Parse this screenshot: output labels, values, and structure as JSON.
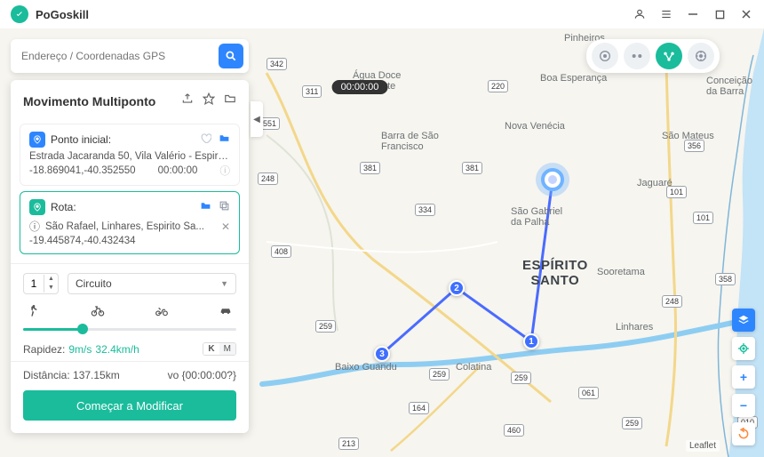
{
  "app": {
    "name": "PoGoskill"
  },
  "search": {
    "placeholder": "Endereço / Coordenadas GPS"
  },
  "panel": {
    "title": "Movimento Multiponto",
    "start_point_label": "Ponto inicial:",
    "start_address": "Estrada Jacaranda 50, Vila Valério - Espirito...",
    "start_coords": "-18.869041,-40.352550",
    "start_time": "00:00:00",
    "route_label": "Rota:",
    "route_address": "São Rafael, Linhares, Espirito Sa...",
    "route_coords": "-19.445874,-40.432434"
  },
  "controls": {
    "loop_count": "1",
    "mode": "Circuito",
    "speed_label": "Rapidez:",
    "speed_ms": "9m/s",
    "speed_kmh": "32.4km/h",
    "unit_k": "K",
    "unit_m": "M",
    "distance_label": "Distância:",
    "distance_value": "137.15km",
    "vo_label": "vo {00:00:00?}",
    "start_button": "Começar a Modificar"
  },
  "timer": "00:00:00",
  "map": {
    "leaflet": "Leaflet",
    "labels": {
      "pinheiros": "Pinheiros",
      "agua_doce": "Água Doce\ndo Norte",
      "boa_esperanca": "Boa Esperança",
      "conceicao": "Conceição\nda Barra",
      "sao_mateus": "São Mateus",
      "nova_venecia": "Nova Venécia",
      "barra_sf": "Barra de São\nFrancisco",
      "sao_gabriel": "São Gabriel\nda Palha",
      "jaguare": "Jaguaré",
      "sooretama": "Sooretama",
      "es": "ESPÍRITO\nSANTO",
      "linhares": "Linhares",
      "baixo_guandu": "Baixo Guandu",
      "colatina": "Colatina"
    },
    "shields": [
      "342",
      "311",
      "248",
      "408",
      "259",
      "164",
      "381",
      "381",
      "220",
      "334",
      "259",
      "259",
      "460",
      "213",
      "061",
      "356",
      "101",
      "101",
      "259",
      "358",
      "010",
      "248",
      "551"
    ],
    "markers": {
      "w1": "1",
      "w2": "2",
      "w3": "3"
    }
  }
}
